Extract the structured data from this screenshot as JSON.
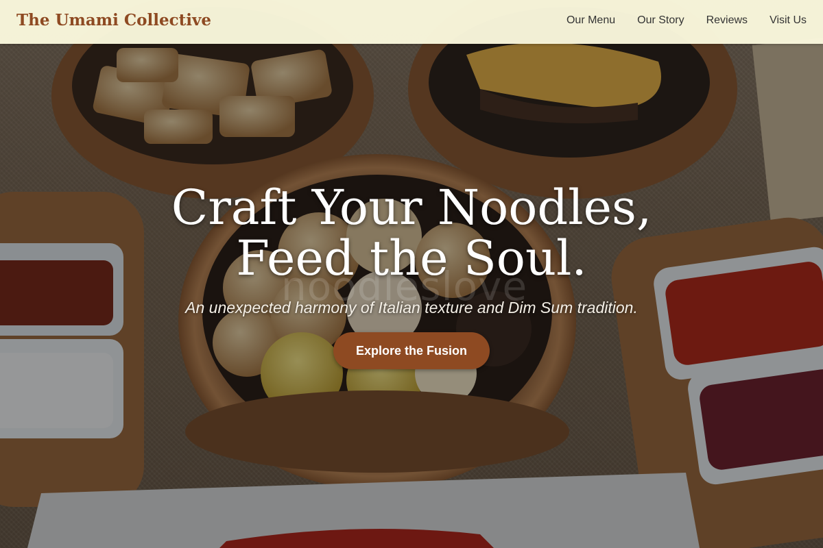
{
  "header": {
    "brand": "The Umami Collective",
    "nav": [
      "Our Menu",
      "Our Story",
      "Reviews",
      "Visit Us"
    ]
  },
  "hero": {
    "headline": "Craft Your Noodles, Feed the Soul.",
    "tagline": "An unexpected harmony of Italian texture and Dim Sum tradition.",
    "cta_label": "Explore the Fusion",
    "watermark": "noodleslove"
  },
  "colors": {
    "accent": "#8e4a22",
    "header_bg": "#fbf9de",
    "text_dark": "#333333",
    "hero_text": "#ffffff"
  },
  "icons": []
}
